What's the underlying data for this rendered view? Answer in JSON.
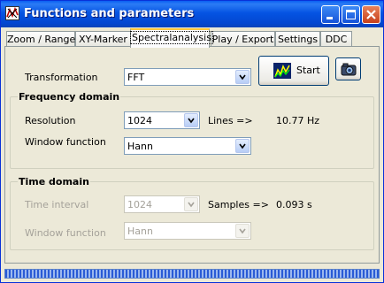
{
  "window": {
    "title": "Functions and parameters"
  },
  "tabs": [
    {
      "label": "Zoom / Range"
    },
    {
      "label": "XY-Marker"
    },
    {
      "label": "Spectralanalysis"
    },
    {
      "label": "Play / Export"
    },
    {
      "label": "Settings"
    },
    {
      "label": "DDC"
    }
  ],
  "active_tab": "Spectralanalysis",
  "transformation": {
    "label": "Transformation",
    "value": "FFT"
  },
  "start_button": {
    "label": "Start"
  },
  "frequency_domain": {
    "title": "Frequency domain",
    "resolution": {
      "label": "Resolution",
      "value": "1024"
    },
    "lines": {
      "label": "Lines =>",
      "value": "10.77 Hz"
    },
    "window_function": {
      "label": "Window function",
      "value": "Hann"
    }
  },
  "time_domain": {
    "title": "Time domain",
    "time_interval": {
      "label": "Time interval",
      "value": "1024"
    },
    "samples": {
      "label": "Samples =>",
      "value": "0.093 s"
    },
    "window_function": {
      "label": "Window function",
      "value": "Hann"
    }
  },
  "icons": {
    "app": "function-graph-icon",
    "start": "spectrum-chart-icon",
    "snapshot": "camera-icon"
  },
  "colors": {
    "titlebar": "#0554E3",
    "face": "#ECE9D8",
    "active_tab_highlight": "#FFC83C",
    "disabled_text": "#A5A29A",
    "progress": "#2A5BD6"
  }
}
